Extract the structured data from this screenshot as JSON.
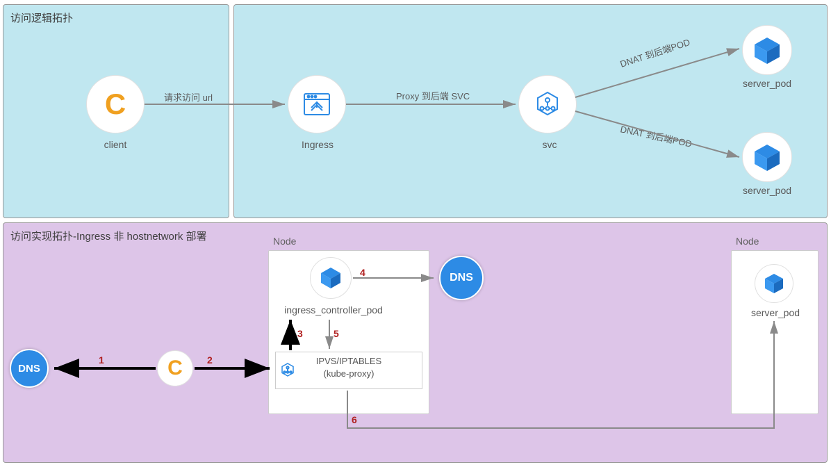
{
  "top": {
    "title_left": "访问逻辑拓扑",
    "client_label": "client",
    "ingress_label": "Ingress",
    "svc_label": "svc",
    "server_pod_label": "server_pod",
    "edge_req_url": "请求访问 url",
    "edge_proxy_svc": "Proxy 到后端 SVC",
    "edge_dnat_pod": "DNAT 到后端POD"
  },
  "bottom": {
    "title": "访问实现拓扑-Ingress 非 hostnetwork 部署",
    "node_box_title": "Node",
    "ingress_pod_label": "ingress_controller_pod",
    "server_pod_label": "server_pod",
    "ipvs_line1": "IPVS/IPTABLES",
    "ipvs_line2": "(kube-proxy)",
    "dns_label": "DNS",
    "step1": "1",
    "step2": "2",
    "step3": "3",
    "step4": "4",
    "step5": "5",
    "step6": "6"
  }
}
